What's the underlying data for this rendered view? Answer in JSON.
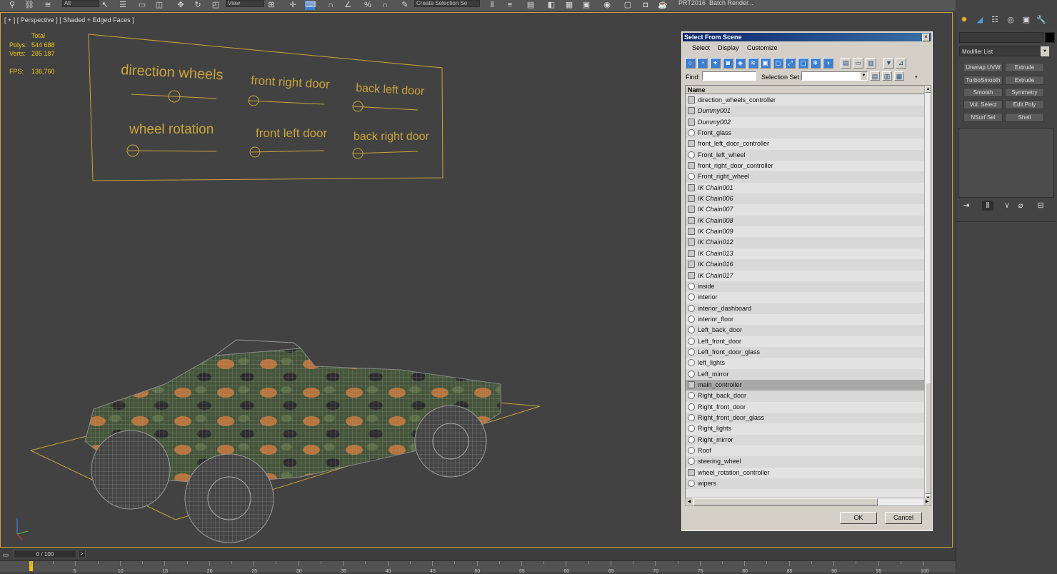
{
  "toolbar": {
    "filter_value": "All",
    "coord_value": "View",
    "selection_set_value": "Create Selection Se",
    "prt_label": "PRT2016",
    "batch_render_label": "Batch Render..."
  },
  "viewport": {
    "label": "[ + ] [ Perspective ] [ Shaded + Edged Faces ]",
    "stats": {
      "total_label": "Total",
      "polys_label": "Polys:",
      "polys_value": "544 688",
      "verts_label": "Verts:",
      "verts_value": "285 187",
      "fps_label": "FPS:",
      "fps_value": "136,760"
    },
    "sliders": [
      {
        "label": "direction wheels",
        "value": 0.5
      },
      {
        "label": "front right door",
        "value": 0.0
      },
      {
        "label": "back left door",
        "value": 0.0
      },
      {
        "label": "wheel rotation",
        "value": 0.0
      },
      {
        "label": "front left door",
        "value": 0.0
      },
      {
        "label": "back right door",
        "value": 0.0
      }
    ],
    "colors": {
      "accent": "#c9a43a",
      "stats": "#f0c419",
      "background": "#424242"
    }
  },
  "dialog": {
    "title": "Select From Scene",
    "close_glyph": "×",
    "menu": [
      "Select",
      "Display",
      "Customize"
    ],
    "find_label": "Find:",
    "find_value": "",
    "selection_set_label": "Selection Set:",
    "selection_set_value": "",
    "column_header": "Name",
    "selected_item": "main_controller",
    "ok_label": "OK",
    "cancel_label": "Cancel",
    "items": [
      {
        "name": "direction_wheels_controller",
        "icon": "helper",
        "italic": false
      },
      {
        "name": "Dummy001",
        "icon": "helper",
        "italic": true
      },
      {
        "name": "Dummy002",
        "icon": "helper",
        "italic": true
      },
      {
        "name": "Front_glass",
        "icon": "geometry",
        "italic": false
      },
      {
        "name": "front_left_door_controller",
        "icon": "helper",
        "italic": false
      },
      {
        "name": "Front_left_wheel",
        "icon": "geometry",
        "italic": false
      },
      {
        "name": "front_right_door_controller",
        "icon": "helper",
        "italic": false
      },
      {
        "name": "Front_right_wheel",
        "icon": "geometry",
        "italic": false
      },
      {
        "name": "IK Chain001",
        "icon": "helper",
        "italic": true
      },
      {
        "name": "IK Chain006",
        "icon": "helper",
        "italic": true
      },
      {
        "name": "IK Chain007",
        "icon": "helper",
        "italic": true
      },
      {
        "name": "IK Chain008",
        "icon": "helper",
        "italic": true
      },
      {
        "name": "IK Chain009",
        "icon": "helper",
        "italic": true
      },
      {
        "name": "IK Chain012",
        "icon": "helper",
        "italic": true
      },
      {
        "name": "IK Chain013",
        "icon": "helper",
        "italic": true
      },
      {
        "name": "IK Chain016",
        "icon": "helper",
        "italic": true
      },
      {
        "name": "IK Chain017",
        "icon": "helper",
        "italic": true
      },
      {
        "name": "inside",
        "icon": "geometry",
        "italic": false
      },
      {
        "name": "interior",
        "icon": "geometry",
        "italic": false
      },
      {
        "name": "interior_dashboard",
        "icon": "geometry",
        "italic": false
      },
      {
        "name": "interior_floor",
        "icon": "geometry",
        "italic": false
      },
      {
        "name": "Left_back_door",
        "icon": "geometry",
        "italic": false
      },
      {
        "name": "Left_front_door",
        "icon": "geometry",
        "italic": false
      },
      {
        "name": "Left_front_door_glass",
        "icon": "geometry",
        "italic": false
      },
      {
        "name": "left_lights",
        "icon": "geometry",
        "italic": false
      },
      {
        "name": "Left_mirror",
        "icon": "geometry",
        "italic": false
      },
      {
        "name": "main_controller",
        "icon": "helper",
        "italic": false
      },
      {
        "name": "Right_back_door",
        "icon": "geometry",
        "italic": false
      },
      {
        "name": "Right_front_door",
        "icon": "geometry",
        "italic": false
      },
      {
        "name": "Right_front_door_glass",
        "icon": "geometry",
        "italic": false
      },
      {
        "name": "Right_lights",
        "icon": "geometry",
        "italic": false
      },
      {
        "name": "Right_mirror",
        "icon": "geometry",
        "italic": false
      },
      {
        "name": "Roof",
        "icon": "geometry",
        "italic": false
      },
      {
        "name": "steering_wheel",
        "icon": "geometry",
        "italic": false
      },
      {
        "name": "wheel_rotation_controller",
        "icon": "helper",
        "italic": false
      },
      {
        "name": "wipers",
        "icon": "geometry",
        "italic": false
      }
    ]
  },
  "command_panel": {
    "modifier_list_label": "Modifier List",
    "modifiers": [
      "Unwrap UVW",
      "Extrude",
      "TurboSmooth",
      "Extrude",
      "Smooth",
      "Symmetry",
      "Vol. Select",
      "Edit Poly",
      "NSurf Sel",
      "Shell"
    ]
  },
  "timeline": {
    "frame_label": "0 / 100",
    "ticks": [
      "5",
      "10",
      "15",
      "20",
      "25",
      "30",
      "35",
      "40",
      "45",
      "50",
      "55",
      "60",
      "65",
      "70",
      "75",
      "80",
      "85",
      "90",
      "95",
      "100"
    ]
  }
}
